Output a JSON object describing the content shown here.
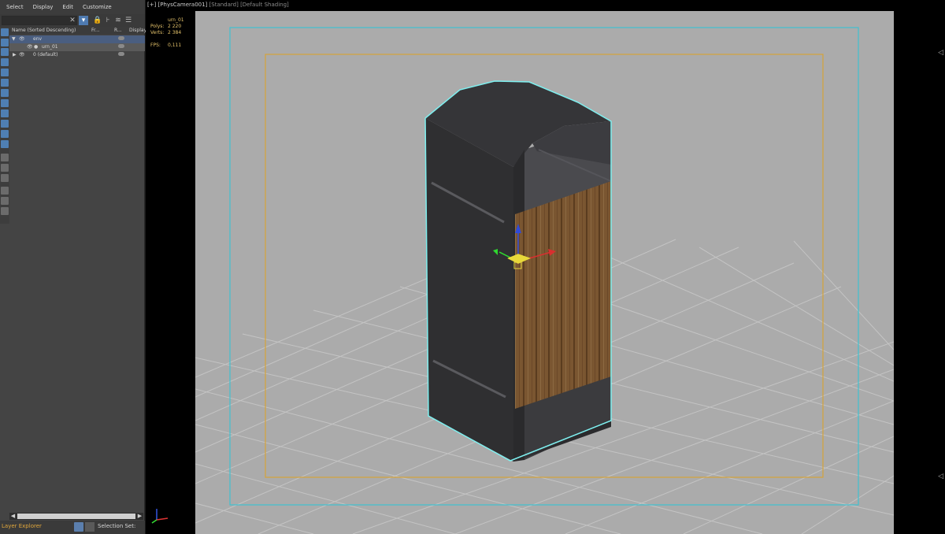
{
  "menu": [
    "Select",
    "Display",
    "Edit",
    "Customize"
  ],
  "search": {
    "value": "",
    "placeholder": ""
  },
  "tree": {
    "headers": {
      "name": "Name (Sorted Descending)",
      "frozen": "Fr...",
      "render": "R...",
      "display": "Display"
    },
    "rows": [
      {
        "label": "env",
        "state": "selected"
      },
      {
        "label": "urn_01",
        "state": "hover"
      },
      {
        "label": "0 (default)",
        "state": "normal"
      }
    ]
  },
  "status": {
    "layer_explorer": "Layer Explorer",
    "selection_set": "Selection Set:"
  },
  "viewport": {
    "label_camera": "[+] [PhysCamera001]",
    "label_mode": "[Standard] [Default Shading]"
  },
  "stats": {
    "object": "urn_01",
    "polys_label": "Polys:",
    "polys_value": "2 220",
    "verts_label": "Verts:",
    "verts_value": "2 384",
    "fps_label": "FPS:",
    "fps_value": "0,111"
  },
  "colors": {
    "safe_frame_outer": "#3fc1d0",
    "safe_frame_inner": "#d6a33a",
    "selection_outline": "#7ef0f0",
    "viewport_bg": "#ababab",
    "grid": "#c9c9c9",
    "wood": "#7a5631",
    "urn_body": "#3a3a3c"
  },
  "icons": [
    "close-icon",
    "filter-icon",
    "lock-icon",
    "hierarchy-icon",
    "layers-icon",
    "eye-icon",
    "render-cloud-icon",
    "viewcube-arrow-icon",
    "axis-tripod-icon"
  ]
}
